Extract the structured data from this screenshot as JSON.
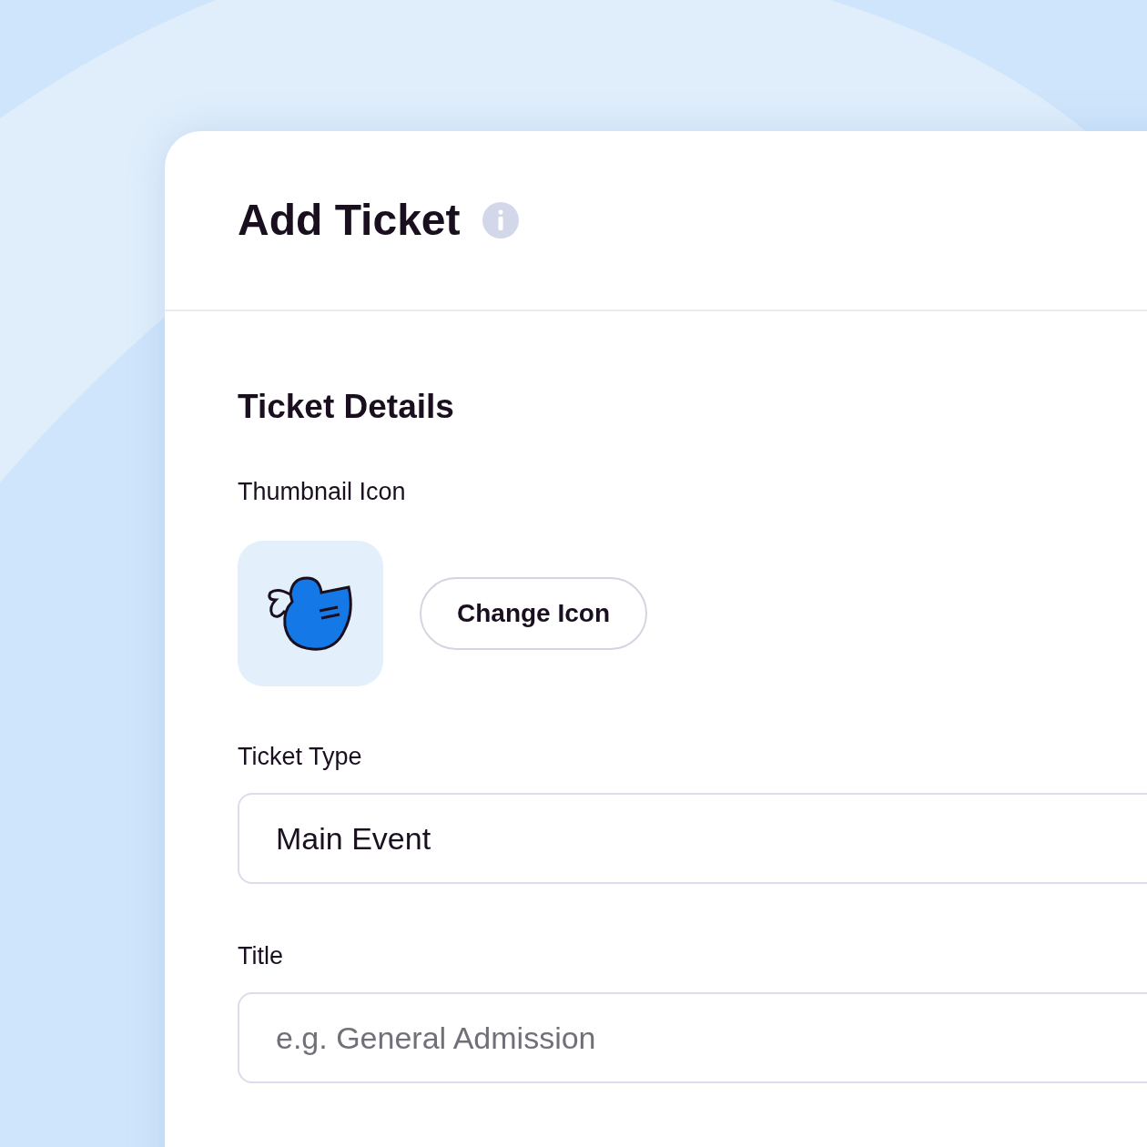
{
  "header": {
    "title": "Add Ticket"
  },
  "section": {
    "title": "Ticket Details"
  },
  "thumbnail": {
    "label": "Thumbnail Icon",
    "button": "Change Icon"
  },
  "fields": [
    {
      "label": "Ticket Type",
      "kind": "select",
      "value": "Main Event"
    },
    {
      "label": "Title",
      "kind": "text",
      "placeholder": "e.g. General Admission"
    }
  ]
}
